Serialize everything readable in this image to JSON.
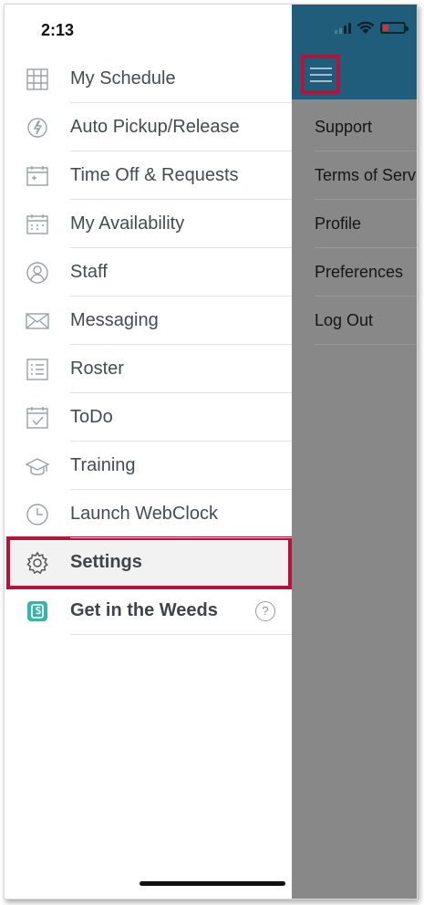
{
  "status_bar": {
    "time": "2:13"
  },
  "drawer_menu": [
    {
      "icon": "calendar-grid-icon",
      "label": "My Schedule"
    },
    {
      "icon": "auto-pickup-icon",
      "label": "Auto Pickup/Release"
    },
    {
      "icon": "time-off-icon",
      "label": "Time Off & Requests"
    },
    {
      "icon": "availability-calendar-icon",
      "label": "My Availability"
    },
    {
      "icon": "staff-person-icon",
      "label": "Staff"
    },
    {
      "icon": "envelope-icon",
      "label": "Messaging"
    },
    {
      "icon": "list-icon",
      "label": "Roster"
    },
    {
      "icon": "todo-check-icon",
      "label": "ToDo"
    },
    {
      "icon": "graduation-cap-icon",
      "label": "Training"
    },
    {
      "icon": "clock-icon",
      "label": "Launch WebClock"
    },
    {
      "icon": "gear-icon",
      "label": "Settings"
    },
    {
      "icon": "weeds-logo-icon",
      "label": "Get in the Weeds"
    }
  ],
  "overlay_menu": [
    {
      "label": "Support"
    },
    {
      "label": "Terms of Service"
    },
    {
      "label": "Profile"
    },
    {
      "label": "Preferences"
    },
    {
      "label": "Log Out"
    }
  ],
  "help": {
    "symbol": "?"
  },
  "colors": {
    "header": "#1f5d7a",
    "highlight_border": "#b3143c",
    "overlay": "#888888",
    "weeds_logo": "#3ab3a8"
  }
}
